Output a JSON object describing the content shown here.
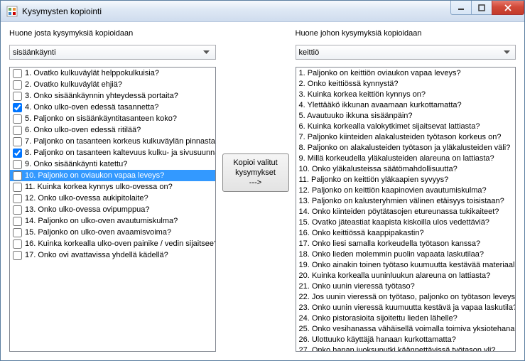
{
  "window": {
    "title": "Kysymysten kopiointi"
  },
  "left": {
    "heading": "Huone josta kysymyksiä kopioidaan",
    "room_selected": "sisäänkäynti",
    "selected_index": 9,
    "items": [
      {
        "n": 1,
        "text": "Ovatko kulkuväylät helppokulkuisia?",
        "checked": false
      },
      {
        "n": 2,
        "text": "Ovatko kulkuväylät ehjiä?",
        "checked": false
      },
      {
        "n": 3,
        "text": "Onko sisäänkäynnin yhteydessä portaita?",
        "checked": false
      },
      {
        "n": 4,
        "text": "Onko ulko-oven edessä tasannetta?",
        "checked": true
      },
      {
        "n": 5,
        "text": "Paljonko on sisäänkäyntitasanteen koko?",
        "checked": false
      },
      {
        "n": 6,
        "text": "Onko ulko-oven edessä ritilää?",
        "checked": false
      },
      {
        "n": 7,
        "text": "Paljonko on tasanteen korkeus kulkuväylän pinnasta?",
        "checked": false
      },
      {
        "n": 8,
        "text": "Paljonko on tasanteen kaltevuus kulku- ja sivusuunnassa?",
        "checked": true
      },
      {
        "n": 9,
        "text": "Onko sisäänkäynti katettu?",
        "checked": false
      },
      {
        "n": 10,
        "text": "Paljonko on oviaukon vapaa leveys?",
        "checked": false
      },
      {
        "n": 11,
        "text": "Kuinka korkea kynnys ulko-ovessa on?",
        "checked": false
      },
      {
        "n": 12,
        "text": "Onko ulko-ovessa aukipitolaite?",
        "checked": false
      },
      {
        "n": 13,
        "text": "Onko ulko-ovessa ovipumppua?",
        "checked": false
      },
      {
        "n": 14,
        "text": "Paljonko on ulko-oven avautumiskulma?",
        "checked": false
      },
      {
        "n": 15,
        "text": "Paljonko on ulko-oven avaamisvoima?",
        "checked": false
      },
      {
        "n": 16,
        "text": "Kuinka korkealla ulko-oven painike / vedin sijaitsee?",
        "checked": false
      },
      {
        "n": 17,
        "text": "Onko ovi avattavissa yhdellä kädellä?",
        "checked": false
      }
    ]
  },
  "middle": {
    "copy_line1": "Kopioi valitut",
    "copy_line2": "kysymykset",
    "copy_line3": "--->"
  },
  "right": {
    "heading": "Huone johon kysymyksiä kopioidaan",
    "room_selected": "keittiö",
    "items": [
      {
        "n": 1,
        "text": "Paljonko on keittiön oviaukon vapaa leveys?"
      },
      {
        "n": 2,
        "text": "Onko keittiössä kynnystä?"
      },
      {
        "n": 3,
        "text": "Kuinka korkea keittiön kynnys on?"
      },
      {
        "n": 4,
        "text": "Ylettääkö ikkunan avaamaan kurkottamatta?"
      },
      {
        "n": 5,
        "text": "Avautuuko ikkuna sisäänpäin?"
      },
      {
        "n": 6,
        "text": "Kuinka korkealla valokytkimet sijaitsevat lattiasta?"
      },
      {
        "n": 7,
        "text": "Paljonko kiinteiden alakalusteiden työtason korkeus on?"
      },
      {
        "n": 8,
        "text": "Paljonko on alakalusteiden työtason ja yläkalusteiden väli?"
      },
      {
        "n": 9,
        "text": "Millä korkeudella yläkalusteiden alareuna on lattiasta?"
      },
      {
        "n": 10,
        "text": "Onko yläkalusteissa säätömahdollisuutta?"
      },
      {
        "n": 11,
        "text": "Paljonko on keittiön yläkaapien syvyys?"
      },
      {
        "n": 12,
        "text": "Paljonko on keittiön kaapinovien avautumiskulma?"
      },
      {
        "n": 13,
        "text": "Paljonko on kalusteryhmien välinen etäisyys toisistaan?"
      },
      {
        "n": 14,
        "text": "Onko kiinteiden pöytätasojen etureunassa tukikaiteet?"
      },
      {
        "n": 15,
        "text": "Ovatko jäteastiat kaapista kiskoilla ulos vedettäviä?"
      },
      {
        "n": 16,
        "text": "Onko keittiössä kaappipakastin?"
      },
      {
        "n": 17,
        "text": "Onko liesi samalla korkeudella työtason kanssa?"
      },
      {
        "n": 18,
        "text": "Onko lieden molemmin puolin vapaata laskutilaa?"
      },
      {
        "n": 19,
        "text": "Onko ainakin toinen työtaso kuumuutta kestävää materiaalia?"
      },
      {
        "n": 20,
        "text": "Kuinka korkealla uuninluukun alareuna on lattiasta?"
      },
      {
        "n": 21,
        "text": "Onko uunin vieressä työtaso?"
      },
      {
        "n": 22,
        "text": "Jos uunin vieressä on työtaso, paljonko on työtason leveys?"
      },
      {
        "n": 23,
        "text": "Onko uunin vieressä kuumuutta kestävä ja vapaa laskutila?"
      },
      {
        "n": 24,
        "text": "Onko pistorasioita sijoitettu lieden lähelle?"
      },
      {
        "n": 25,
        "text": "Onko vesihanassa vähäisellä voimalla toimiva yksiotehana?"
      },
      {
        "n": 26,
        "text": "Ulottuuko käyttäjä hanaan kurkottamatta?"
      },
      {
        "n": 27,
        "text": "Onko hanan juoksuputki käännettävissä työtason yli?"
      }
    ]
  }
}
